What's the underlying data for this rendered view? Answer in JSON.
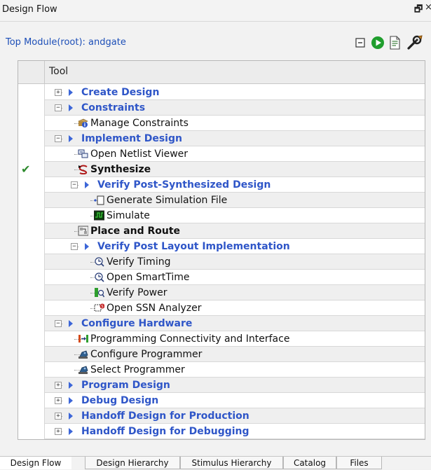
{
  "window": {
    "title": "Design Flow",
    "float_glyph": "🗗",
    "close_glyph": "×"
  },
  "header": {
    "top_module": "Top Module(root): andgate",
    "buttons": [
      {
        "name": "collapse-all-icon"
      },
      {
        "name": "run-icon",
        "color": "#1f9e2d"
      },
      {
        "name": "report-icon"
      },
      {
        "name": "options-icon"
      }
    ]
  },
  "tree": {
    "column_header": "Tool",
    "rows": [
      {
        "label": "Create Design",
        "kind": "group",
        "level": 0,
        "expander": "+",
        "status": ""
      },
      {
        "label": "Constraints",
        "kind": "group",
        "level": 0,
        "expander": "−",
        "status": ""
      },
      {
        "label": "Manage Constraints",
        "kind": "tool",
        "level": 1,
        "icon": "constraints-icon",
        "status": ""
      },
      {
        "label": "Implement Design",
        "kind": "group",
        "level": 0,
        "expander": "−",
        "status": ""
      },
      {
        "label": "Open Netlist Viewer",
        "kind": "tool",
        "level": 1,
        "icon": "netlist-viewer-icon",
        "status": ""
      },
      {
        "label": "Synthesize",
        "kind": "bold",
        "level": 1,
        "icon": "synthesize-icon",
        "status": "✔"
      },
      {
        "label": "Verify Post-Synthesized Design",
        "kind": "group",
        "level": 1,
        "expander": "−",
        "status": ""
      },
      {
        "label": "Generate Simulation File",
        "kind": "tool",
        "level": 2,
        "icon": "file-icon",
        "status": ""
      },
      {
        "label": "Simulate",
        "kind": "tool",
        "level": 2,
        "icon": "waveform-icon",
        "status": ""
      },
      {
        "label": "Place and Route",
        "kind": "bold",
        "level": 1,
        "icon": "place-route-icon",
        "status": ""
      },
      {
        "label": "Verify Post Layout Implementation",
        "kind": "group",
        "level": 1,
        "expander": "−",
        "status": ""
      },
      {
        "label": "Verify Timing",
        "kind": "tool",
        "level": 2,
        "icon": "timing-icon",
        "status": ""
      },
      {
        "label": "Open SmartTime",
        "kind": "tool",
        "level": 2,
        "icon": "smarttime-icon",
        "status": ""
      },
      {
        "label": "Verify Power",
        "kind": "tool",
        "level": 2,
        "icon": "power-icon",
        "status": ""
      },
      {
        "label": "Open SSN Analyzer",
        "kind": "tool",
        "level": 2,
        "icon": "ssn-analyzer-icon",
        "status": ""
      },
      {
        "label": "Configure Hardware",
        "kind": "group",
        "level": 0,
        "expander": "−",
        "status": ""
      },
      {
        "label": "Programming Connectivity and Interface",
        "kind": "tool",
        "level": 1,
        "icon": "connectivity-icon",
        "status": ""
      },
      {
        "label": "Configure Programmer",
        "kind": "tool",
        "level": 1,
        "icon": "programmer-icon",
        "status": ""
      },
      {
        "label": "Select Programmer",
        "kind": "tool",
        "level": 1,
        "icon": "programmer-icon",
        "status": ""
      },
      {
        "label": "Program Design",
        "kind": "group",
        "level": 0,
        "expander": "+",
        "status": ""
      },
      {
        "label": "Debug Design",
        "kind": "group",
        "level": 0,
        "expander": "+",
        "status": ""
      },
      {
        "label": "Handoff Design for Production",
        "kind": "group",
        "level": 0,
        "expander": "+",
        "status": ""
      },
      {
        "label": "Handoff Design for Debugging",
        "kind": "group",
        "level": 0,
        "expander": "+",
        "status": ""
      }
    ]
  },
  "tabs": [
    {
      "label": "Design Flow",
      "active": true
    },
    {
      "label": "Design Hierarchy",
      "active": false
    },
    {
      "label": "Stimulus Hierarchy",
      "active": false
    },
    {
      "label": "Catalog",
      "active": false
    },
    {
      "label": "Files",
      "active": false
    }
  ],
  "colors": {
    "group_text": "#2f56c8",
    "link_text": "#1d4fb8",
    "check": "#2e8b2e"
  }
}
